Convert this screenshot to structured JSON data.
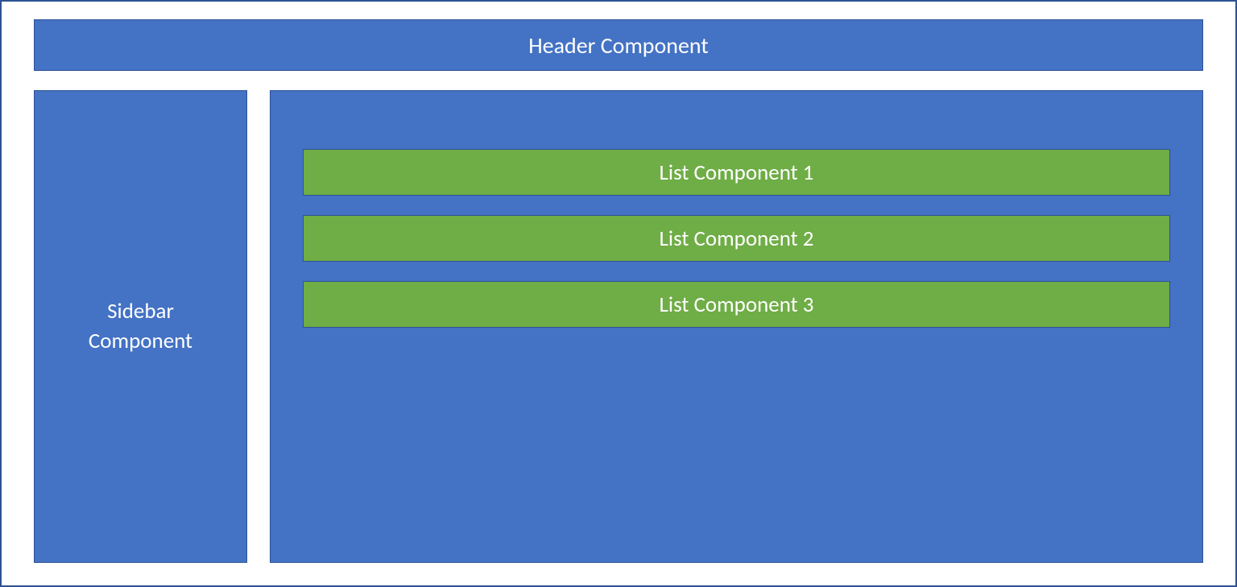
{
  "header": {
    "label": "Header Component"
  },
  "sidebar": {
    "label": "Sidebar\nComponent"
  },
  "main": {
    "list_items": [
      {
        "label": "List Component 1"
      },
      {
        "label": "List Component 2"
      },
      {
        "label": "List Component 3"
      }
    ]
  },
  "colors": {
    "box_blue": "#4472c4",
    "box_green": "#6fad46",
    "border": "#2d5294",
    "text": "#ffffff"
  }
}
